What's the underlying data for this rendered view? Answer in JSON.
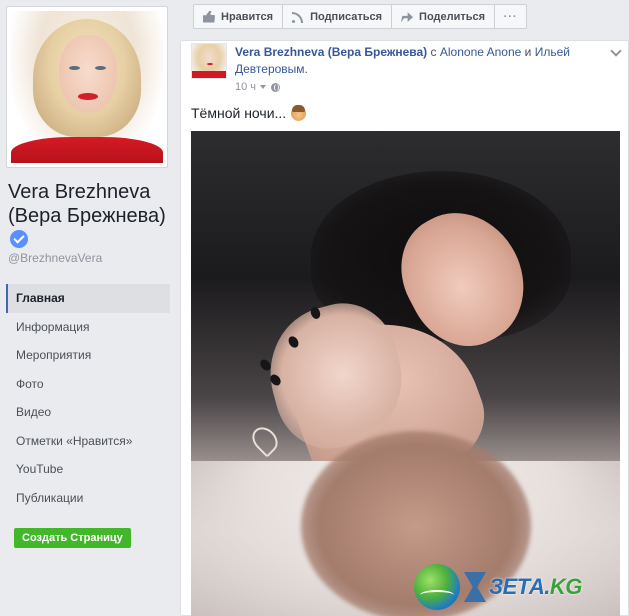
{
  "sidebar": {
    "page_name": "Vera Brezhneva (Вера Брежнева)",
    "username": "@BrezhnevaVera",
    "nav_items": [
      {
        "label": "Главная",
        "active": true
      },
      {
        "label": "Информация"
      },
      {
        "label": "Мероприятия"
      },
      {
        "label": "Фото"
      },
      {
        "label": "Видео"
      },
      {
        "label": "Отметки «Нравится»"
      },
      {
        "label": "YouTube"
      },
      {
        "label": "Публикации"
      }
    ],
    "create_page_label": "Создать Страницу"
  },
  "actionbar": {
    "like_label": "Нравится",
    "subscribe_label": "Подписаться",
    "share_label": "Поделиться",
    "more_label": "···"
  },
  "post": {
    "author": "Vera Brezhneva (Вера Брежнева)",
    "with_text": "с",
    "tag1": "Alonone Anone",
    "and_text": "и",
    "tag2": "Ильей Девтеровым",
    "period": ".",
    "time": "10 ч",
    "text": "Тёмной ночи..."
  },
  "watermark": {
    "text_main": "ЗЕТА.",
    "text_kg": "KG"
  },
  "colors": {
    "accent": "#4267b2",
    "link": "#365899",
    "create_button": "#42b72a",
    "verified": "#5890ff"
  }
}
